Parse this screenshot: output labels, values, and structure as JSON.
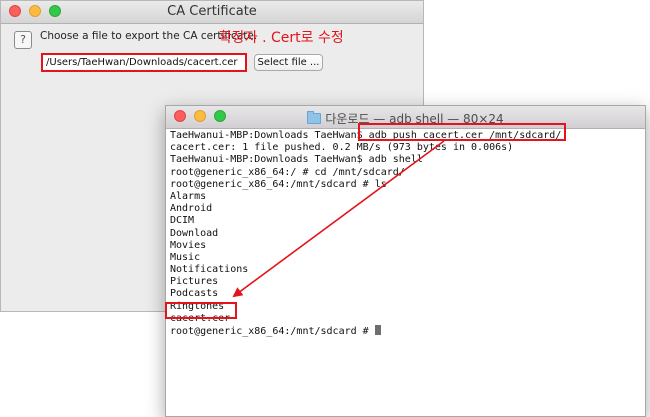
{
  "dialog": {
    "title": "CA Certificate",
    "help_glyph": "?",
    "prompt": "Choose a file to export the CA certificate.",
    "annotation": "확장자 . Cert로 수정",
    "file_path_value": "/Users/TaeHwan/Downloads/cacert.cer",
    "select_button": "Select file ..."
  },
  "terminal": {
    "title": "다운로드 — adb shell — 80×24",
    "lines": [
      "TaeHwanui-MBP:Downloads TaeHwan$ adb push cacert.cer /mnt/sdcard/",
      "cacert.cer: 1 file pushed. 0.2 MB/s (973 bytes in 0.006s)",
      "TaeHwanui-MBP:Downloads TaeHwan$ adb shell",
      "root@generic_x86_64:/ # cd /mnt/sdcard/",
      "root@generic_x86_64:/mnt/sdcard # ls",
      "Alarms",
      "Android",
      "DCIM",
      "Download",
      "Movies",
      "Music",
      "Notifications",
      "Pictures",
      "Podcasts",
      "Ringtones",
      "cacert.cer",
      "root@generic_x86_64:/mnt/sdcard # "
    ]
  },
  "colors": {
    "annotation_red": "#e3141b"
  },
  "icons": {
    "help": "question-mark-icon",
    "title_folder": "folder-icon",
    "arrow": "arrow-icon"
  }
}
